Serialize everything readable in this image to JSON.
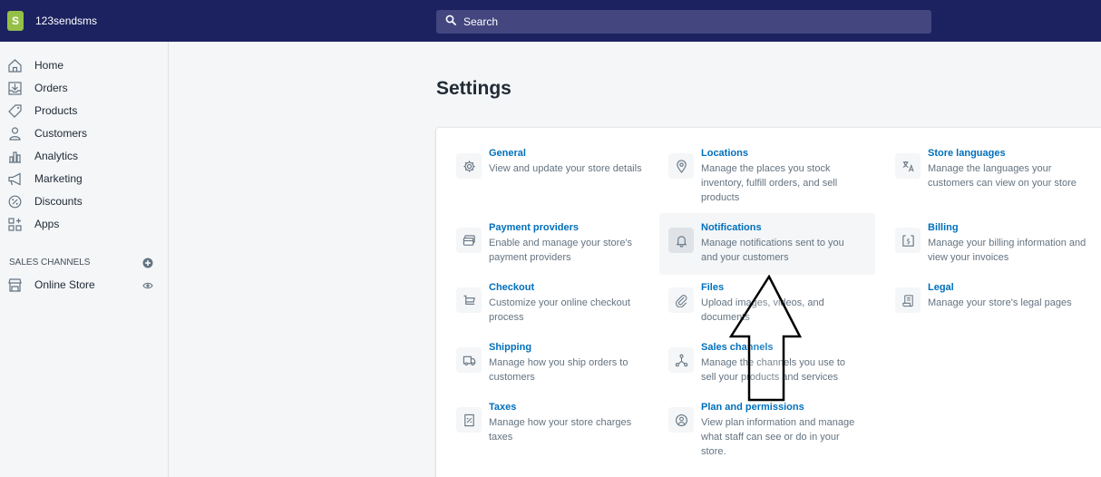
{
  "store": {
    "name": "123sendsms"
  },
  "search": {
    "placeholder": "Search"
  },
  "sidebar": {
    "items": [
      {
        "label": "Home",
        "icon": "home-icon"
      },
      {
        "label": "Orders",
        "icon": "orders-icon"
      },
      {
        "label": "Products",
        "icon": "products-icon"
      },
      {
        "label": "Customers",
        "icon": "customers-icon"
      },
      {
        "label": "Analytics",
        "icon": "analytics-icon"
      },
      {
        "label": "Marketing",
        "icon": "marketing-icon"
      },
      {
        "label": "Discounts",
        "icon": "discounts-icon"
      },
      {
        "label": "Apps",
        "icon": "apps-icon"
      }
    ],
    "sales_channels_heading": "SALES CHANNELS",
    "online_store": "Online Store"
  },
  "page": {
    "title": "Settings"
  },
  "settings": [
    {
      "title": "General",
      "desc": "View and update your store details",
      "icon": "gear-icon"
    },
    {
      "title": "Locations",
      "desc": "Manage the places you stock inventory, fulfill orders, and sell products",
      "icon": "location-pin-icon"
    },
    {
      "title": "Store languages",
      "desc": "Manage the languages your customers can view on your store",
      "icon": "translate-icon"
    },
    {
      "title": "Payment providers",
      "desc": "Enable and manage your store's payment providers",
      "icon": "payment-icon"
    },
    {
      "title": "Notifications",
      "desc": "Manage notifications sent to you and your customers",
      "icon": "bell-icon"
    },
    {
      "title": "Billing",
      "desc": "Manage your billing information and view your invoices",
      "icon": "billing-icon"
    },
    {
      "title": "Checkout",
      "desc": "Customize your online checkout process",
      "icon": "cart-icon"
    },
    {
      "title": "Files",
      "desc": "Upload images, videos, and documents",
      "icon": "paperclip-icon"
    },
    {
      "title": "Legal",
      "desc": "Manage your store's legal pages",
      "icon": "legal-icon"
    },
    {
      "title": "Shipping",
      "desc": "Manage how you ship orders to customers",
      "icon": "truck-icon"
    },
    {
      "title": "Sales channels",
      "desc": "Manage the channels you use to sell your products and services",
      "icon": "channels-icon"
    },
    {
      "title": "Taxes",
      "desc": "Manage how your store charges taxes",
      "icon": "taxes-icon"
    },
    {
      "title": "Plan and permissions",
      "desc": "View plan information and manage what staff can see or do in your store.",
      "icon": "plan-icon"
    }
  ],
  "colors": {
    "topbar": "#1c2260",
    "search": "#43467f",
    "link": "#006fbb",
    "subdued": "#637381",
    "brand": "#95bf47"
  }
}
